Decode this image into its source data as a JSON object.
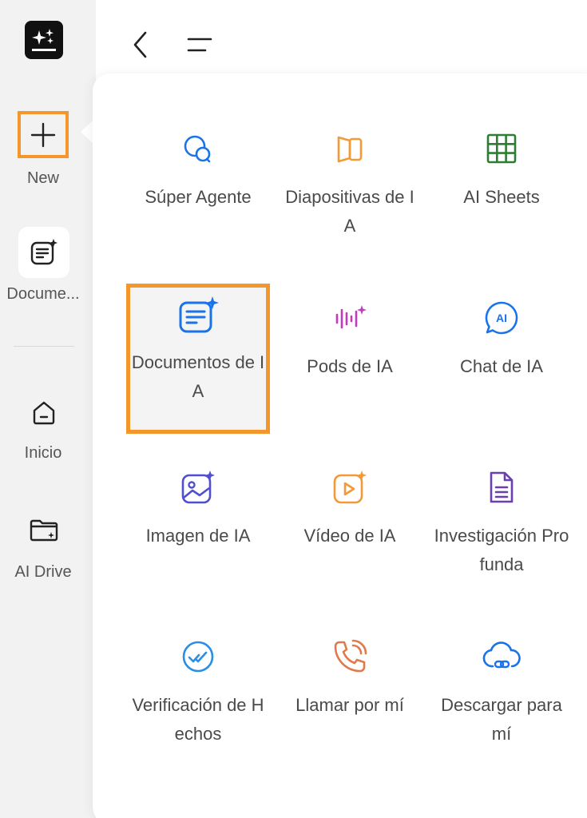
{
  "sidebar": {
    "new_label": "New",
    "doc_label": "Docume...",
    "home_label": "Inicio",
    "drive_label": "AI Drive"
  },
  "menu": {
    "items": [
      {
        "label": "Súper Agente",
        "icon": "chat-bubbles-icon",
        "color": "#1a73e8"
      },
      {
        "label": "Diapositivas de IA",
        "icon": "slides-icon",
        "color": "#f29a38"
      },
      {
        "label": "AI Sheets",
        "icon": "grid-icon",
        "color": "#2e7d32"
      },
      {
        "label": "Documentos de IA",
        "icon": "document-sparkle-icon",
        "color": "#1a73e8"
      },
      {
        "label": "Pods de IA",
        "icon": "audio-wave-icon",
        "color": "#c23bbd"
      },
      {
        "label": "Chat de IA",
        "icon": "ai-chat-icon",
        "color": "#1a73e8"
      },
      {
        "label": "Imagen de IA",
        "icon": "image-sparkle-icon",
        "color": "#4f4fd0"
      },
      {
        "label": "Vídeo de IA",
        "icon": "video-sparkle-icon",
        "color": "#f29a38"
      },
      {
        "label": "Investigación Profunda",
        "icon": "file-text-icon",
        "color": "#6a3fb0"
      },
      {
        "label": "Verificación de Hechos",
        "icon": "check-circle-icon",
        "color": "#2a8ee6"
      },
      {
        "label": "Llamar por mí",
        "icon": "phone-icon",
        "color": "#e07a4a"
      },
      {
        "label": "Descargar para mí",
        "icon": "cloud-link-icon",
        "color": "#1a73e8"
      }
    ]
  },
  "colors": {
    "highlight": "#f5962b",
    "sidebar_bg": "#f2f2f2"
  }
}
